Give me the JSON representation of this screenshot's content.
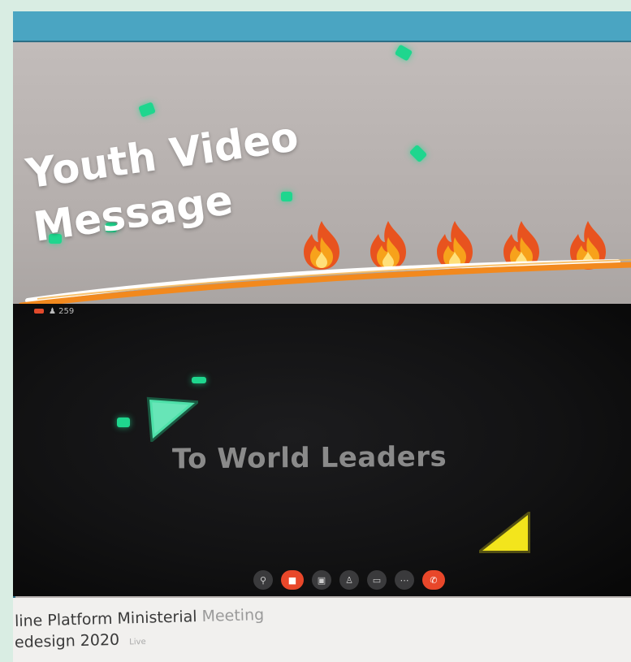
{
  "story": {
    "title_line1": "Youth Video",
    "title_line2": "Message",
    "flame_count": 5,
    "colors": {
      "header": "#4aa5c2",
      "confetti": "#1fd68e",
      "underline_orange": "#f2891e",
      "live_red": "#e8472a"
    }
  },
  "video": {
    "viewer_count": "259",
    "overlay_text": "To World Leaders",
    "controls": [
      {
        "icon": "mic-icon",
        "glyph": "⚲"
      },
      {
        "icon": "camera-icon",
        "glyph": "■"
      },
      {
        "icon": "share-icon",
        "glyph": "▣"
      },
      {
        "icon": "participants-icon",
        "glyph": "♙"
      },
      {
        "icon": "chat-icon",
        "glyph": "▭"
      },
      {
        "icon": "more-icon",
        "glyph": "⋯"
      },
      {
        "icon": "end-call-icon",
        "glyph": "✆"
      }
    ]
  },
  "caption": {
    "line1_main": "line Platform Ministerial",
    "line1_faded": "Meeting",
    "line2_main": "edesign 2020",
    "line2_tiny": "Live"
  }
}
